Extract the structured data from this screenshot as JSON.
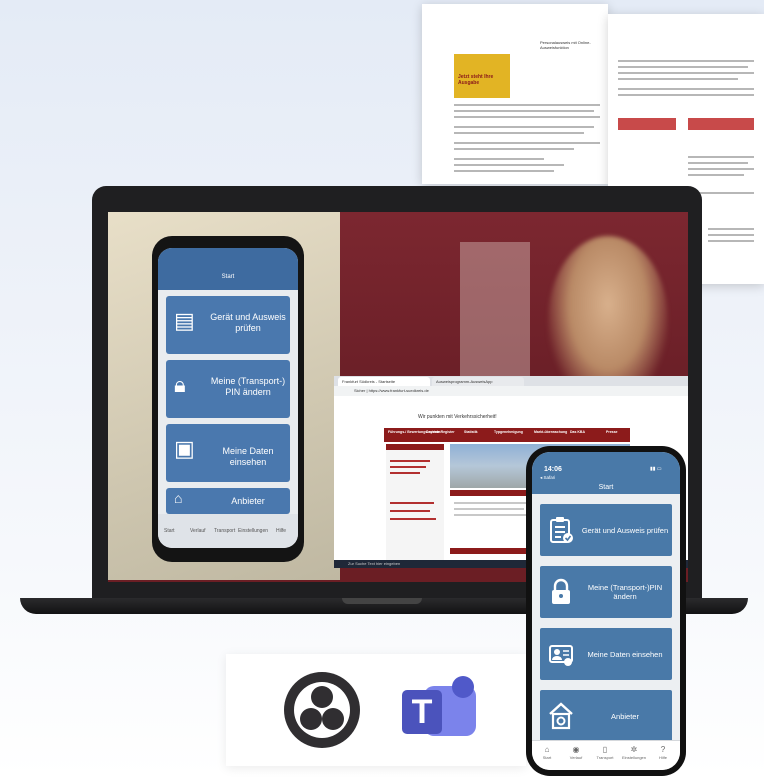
{
  "colors": {
    "app_header": "#4979a8",
    "tile": "#4979a8",
    "laptop": "#1f1f21",
    "site_red": "#8c1b1b"
  },
  "documents": {
    "left": {
      "yellow_box_text": "Jetzt steht Ihre Ausgabe",
      "heading": "Personalausweis mit Online-Ausweisfunktion"
    }
  },
  "webcam_phone": {
    "title": "Start",
    "tiles": [
      {
        "label": "Gerät und Ausweis prüfen",
        "icon": "clipboard-check-icon"
      },
      {
        "label": "Meine (Transport-) PIN ändern",
        "icon": "lock-icon"
      },
      {
        "label": "Meine Daten einsehen",
        "icon": "id-card-icon"
      },
      {
        "label": "Anbieter",
        "icon": "house-icon"
      }
    ],
    "nav": [
      "Start",
      "Verlauf",
      "Transport",
      "Einstellungen",
      "Hilfe"
    ]
  },
  "browser": {
    "tab1": "Frankfurt Südkreis - Startseite",
    "tab2": "Ausweisprogramm-AusweisApp",
    "url": "Sicher | https://www.frankfurt-suedkreis.de",
    "site_tagline": "Wir punkten mit Verkehrssicherheit!",
    "nav": [
      "Führungs-/ Bewertungs-system",
      "Zentrale Register",
      "Statistik",
      "Typgenehmigung",
      "Markt-überwachung",
      "Das KBA",
      "Presse"
    ],
    "taskbar_search": "Zur Suche Text hier eingeben"
  },
  "app_phone": {
    "time": "14:06",
    "back_label": "◂ Safari",
    "title": "Start",
    "tiles": [
      {
        "label": "Gerät und Ausweis prüfen",
        "icon": "clipboard-check-icon"
      },
      {
        "label": "Meine (Transport-)PIN ändern",
        "icon": "lock-icon"
      },
      {
        "label": "Meine Daten einsehen",
        "icon": "id-card-icon"
      },
      {
        "label": "Anbieter",
        "icon": "house-icon"
      }
    ],
    "nav": [
      {
        "label": "Start",
        "icon": "home-icon"
      },
      {
        "label": "Verlauf",
        "icon": "history-icon"
      },
      {
        "label": "Transport",
        "icon": "phone-icon"
      },
      {
        "label": "Einstellungen",
        "icon": "gear-icon"
      },
      {
        "label": "Hilfe",
        "icon": "help-icon"
      }
    ]
  },
  "logos": {
    "obs": "obs-studio-logo",
    "teams": "microsoft-teams-logo",
    "teams_letter": "T"
  }
}
